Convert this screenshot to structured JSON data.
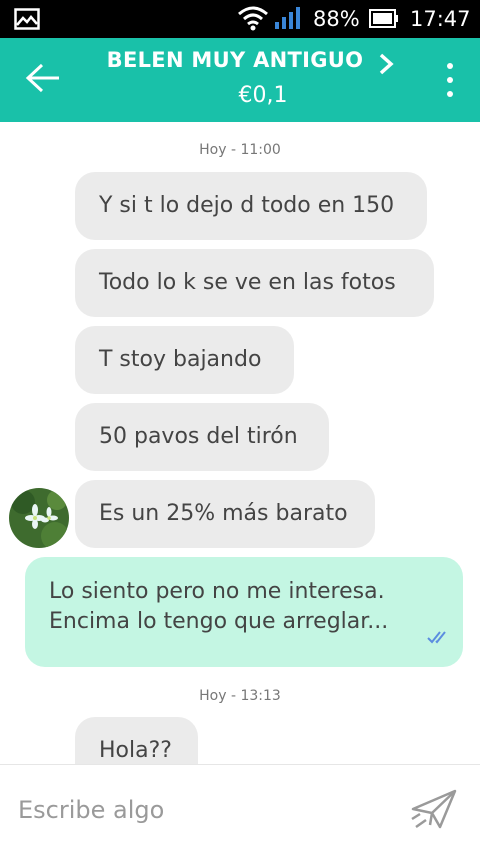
{
  "status_bar": {
    "battery_percent": "88%",
    "time": "17:47",
    "icons": [
      "image-notification-icon",
      "wifi-icon",
      "signal-icon",
      "battery-icon"
    ]
  },
  "header": {
    "title": "BELEN MUY ANTIGUO",
    "price": "€0,1",
    "icons": [
      "back-arrow-icon",
      "chevron-right-icon",
      "more-vertical-icon"
    ],
    "background_color": "#19c1a9"
  },
  "messages": [
    {
      "type": "date",
      "text": "Hoy - 11:00"
    },
    {
      "type": "incoming",
      "text": "Y si t lo dejo d todo en 150"
    },
    {
      "type": "incoming",
      "text": "Todo lo k se ve en las fotos"
    },
    {
      "type": "incoming",
      "text": "T stoy bajando"
    },
    {
      "type": "incoming",
      "text": "50 pavos del tirón"
    },
    {
      "type": "incoming",
      "text": "Es un 25% más barato",
      "avatar": true
    },
    {
      "type": "outgoing",
      "lines": [
        "Lo siento pero no me interesa.",
        "Encima lo tengo que arreglar..."
      ],
      "read_ticks": true
    },
    {
      "type": "date",
      "text": "Hoy - 13:13"
    },
    {
      "type": "incoming",
      "text": "Hola??"
    }
  ],
  "colors": {
    "incoming_bubble": "#ebebeb",
    "outgoing_bubble": "#c4f6e3",
    "read_ticks": "#5b8de0"
  },
  "input": {
    "placeholder": "Escribe algo",
    "value": "",
    "send_icon": "send-paper-plane-icon"
  }
}
